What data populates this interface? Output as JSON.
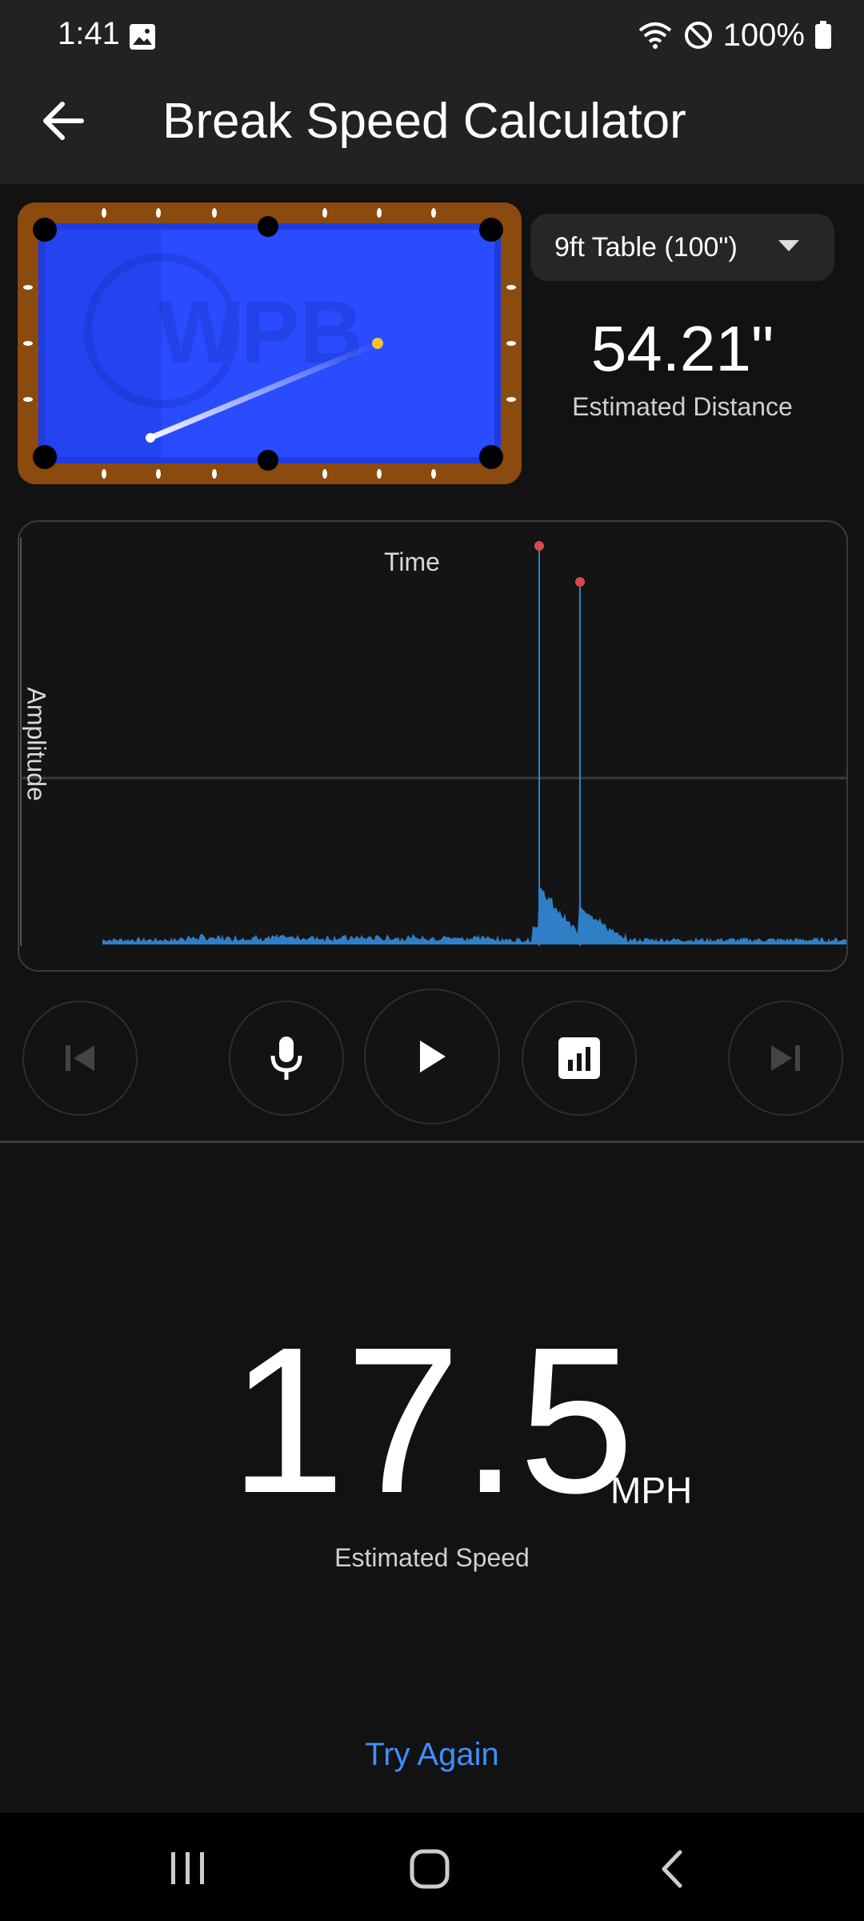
{
  "status_bar": {
    "time": "1:41",
    "battery": "100%"
  },
  "app_bar": {
    "title": "Break Speed Calculator"
  },
  "table_selector": {
    "selected": "9ft Table (100\")"
  },
  "distance": {
    "value": "54.21\"",
    "label": "Estimated Distance"
  },
  "chart": {
    "x_label": "Time",
    "y_label": "Amplitude"
  },
  "speed": {
    "value": "17.5",
    "unit": "MPH",
    "label": "Estimated Speed"
  },
  "actions": {
    "try_again": "Try Again"
  },
  "colors": {
    "accent": "#3f8fff",
    "table_felt": "#2a4cff",
    "rail": "#8b4a0e",
    "waveform": "#2f7fc7",
    "peak_marker": "#d84a4a"
  }
}
